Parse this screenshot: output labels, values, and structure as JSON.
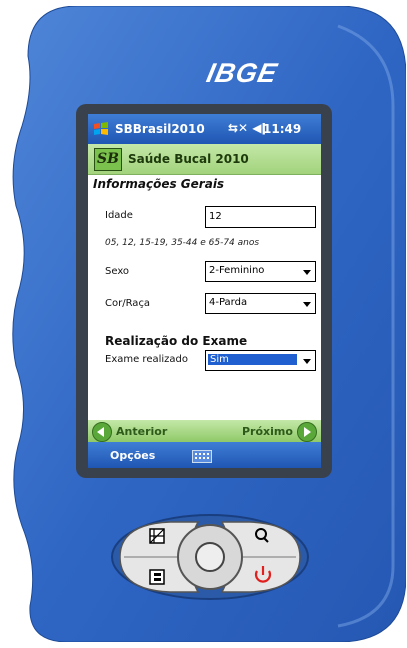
{
  "device": {
    "brand": "IBGE"
  },
  "status_bar": {
    "app_title": "SBBrasil2010",
    "time": "11:49"
  },
  "header": {
    "logo_text": "SB",
    "title": "Saúde Bucal 2010"
  },
  "form": {
    "section_title": "Informações Gerais",
    "idade": {
      "label": "Idade",
      "value": "12",
      "hint": "05, 12, 15-19, 35-44 e 65-74 anos"
    },
    "sexo": {
      "label": "Sexo",
      "value": "2-Feminino"
    },
    "cor": {
      "label": "Cor/Raça",
      "value": "4-Parda"
    },
    "section2_title": "Realização do Exame",
    "exame": {
      "label": "Exame realizado",
      "value": "Sim"
    }
  },
  "nav": {
    "prev_label": "Anterior",
    "next_label": "Próximo"
  },
  "menu": {
    "options_label": "Opções"
  },
  "colors": {
    "shell_blue": "#2f66c4",
    "accent_green": "#a2d37c",
    "title_blue": "#1f56b3"
  }
}
